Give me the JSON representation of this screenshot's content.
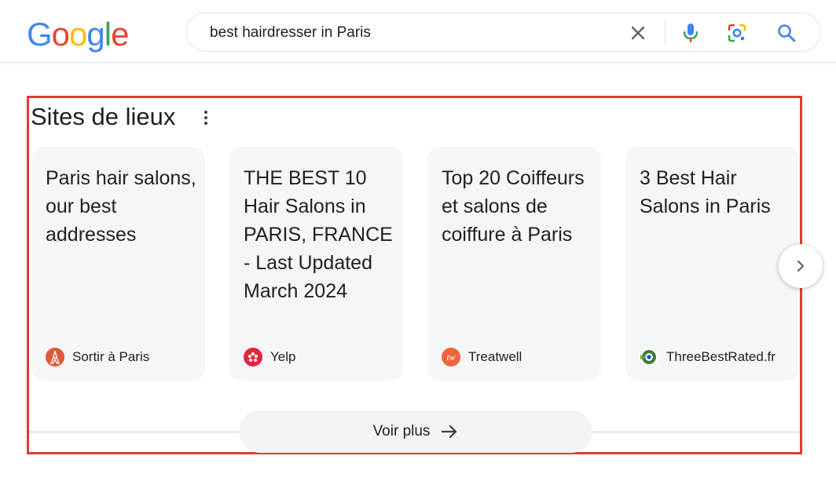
{
  "header": {
    "logo_text": "Google",
    "search_value": "best hairdresser in Paris"
  },
  "section": {
    "title": "Sites de lieux",
    "cards": [
      {
        "title": "Paris hair salons, our best addresses",
        "source": "Sortir à Paris",
        "favicon": "eiffel-tower-icon",
        "favicon_color": "#e0583a"
      },
      {
        "title": "THE BEST 10 Hair Salons in PARIS, FRANCE - Last Updated March 2024",
        "source": "Yelp",
        "favicon": "yelp-icon",
        "favicon_color": "#e4253d"
      },
      {
        "title": "Top 20 Coiffeurs et salons de coiffure à Paris",
        "source": "Treatwell",
        "favicon": "treatwell-icon",
        "favicon_color": "#f0643c",
        "favicon_text": "tw"
      },
      {
        "title": "3 Best Hair Salons in Paris",
        "source": "ThreeBestRated.fr",
        "favicon": "threebestrated-icon",
        "favicon_color": "#3a7d3a"
      }
    ],
    "more_label": "Voir plus"
  },
  "colors": {
    "highlight_border": "#e53935",
    "card_bg": "#f5f6f8",
    "google_blue": "#4285f4",
    "google_red": "#ea4335",
    "google_yellow": "#fbbc05",
    "google_green": "#34a853"
  }
}
